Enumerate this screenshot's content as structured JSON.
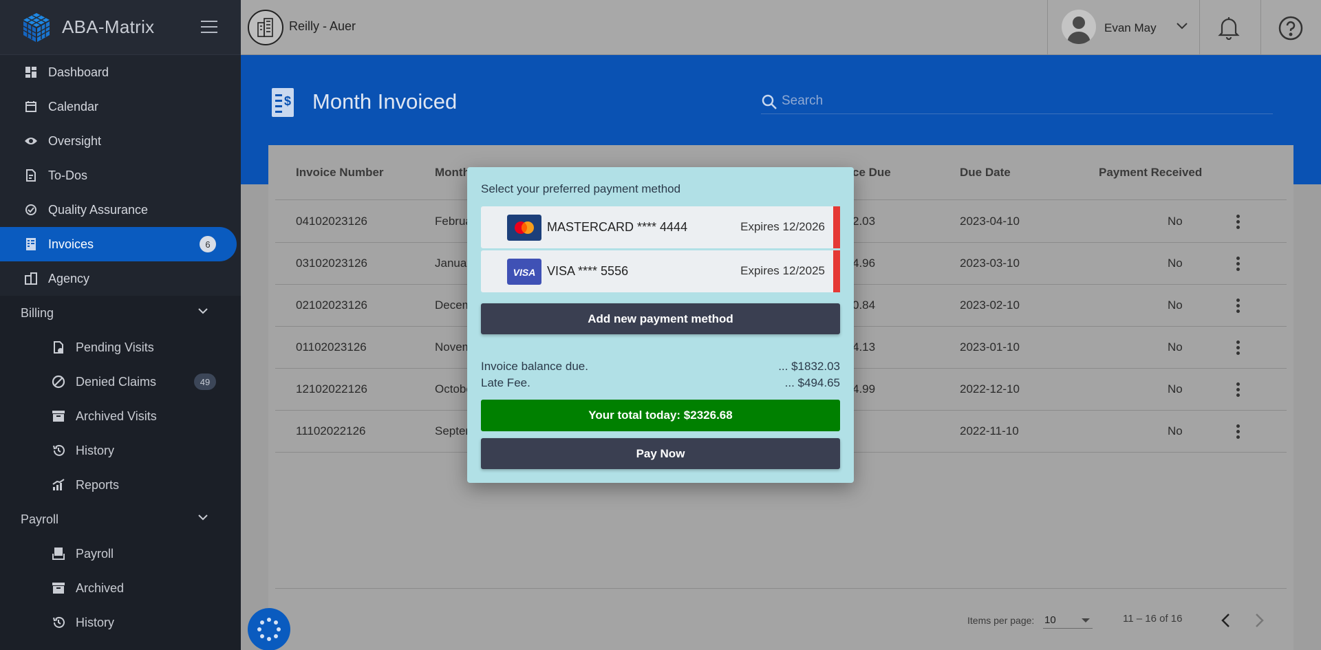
{
  "sidebar": {
    "brand": "ABA-Matrix",
    "items": [
      {
        "label": "Dashboard",
        "icon": "dashboard-icon"
      },
      {
        "label": "Calendar",
        "icon": "calendar-icon"
      },
      {
        "label": "Oversight",
        "icon": "eye-icon"
      },
      {
        "label": "To-Dos",
        "icon": "todo-icon"
      },
      {
        "label": "Quality Assurance",
        "icon": "quality-icon"
      },
      {
        "label": "Invoices",
        "icon": "invoice-icon",
        "badge": "6",
        "active": true
      },
      {
        "label": "Agency",
        "icon": "agency-icon"
      }
    ],
    "billing": {
      "label": "Billing",
      "items": [
        {
          "label": "Pending Visits",
          "icon": "pending-visits-icon"
        },
        {
          "label": "Denied Claims",
          "icon": "denied-icon",
          "badge": "49"
        },
        {
          "label": "Archived Visits",
          "icon": "archive-icon"
        },
        {
          "label": "History",
          "icon": "history-icon"
        },
        {
          "label": "Reports",
          "icon": "reports-icon"
        }
      ]
    },
    "payroll": {
      "label": "Payroll",
      "items": [
        {
          "label": "Payroll",
          "icon": "payroll-icon"
        },
        {
          "label": "Archived",
          "icon": "archive-icon"
        },
        {
          "label": "History",
          "icon": "history-icon"
        }
      ]
    }
  },
  "topbar": {
    "org_name": "Reilly - Auer",
    "user_name": "Evan May"
  },
  "header": {
    "title": "Month Invoiced",
    "search_placeholder": "Search"
  },
  "table": {
    "columns": [
      "Invoice Number",
      "Month I",
      "ce Due",
      "Due Date",
      "Payment Received"
    ],
    "rows": [
      {
        "invoice": "04102023126",
        "month": "Februar",
        "due": "2.03",
        "date": "2023-04-10",
        "received": "No"
      },
      {
        "invoice": "03102023126",
        "month": "January",
        "due": "4.96",
        "date": "2023-03-10",
        "received": "No"
      },
      {
        "invoice": "02102023126",
        "month": "Decemb",
        "due": "0.84",
        "date": "2023-02-10",
        "received": "No"
      },
      {
        "invoice": "01102023126",
        "month": "Novemb",
        "due": "4.13",
        "date": "2023-01-10",
        "received": "No"
      },
      {
        "invoice": "12102022126",
        "month": "October",
        "due": "4.99",
        "date": "2022-12-10",
        "received": "No"
      },
      {
        "invoice": "11102022126",
        "month": "Septem",
        "due": "",
        "date": "2022-11-10",
        "received": "No"
      }
    ]
  },
  "pagination": {
    "items_per_page_label": "Items per page:",
    "items_per_page": "10",
    "range": "11 – 16 of 16"
  },
  "modal": {
    "title": "Select your preferred payment method",
    "methods": [
      {
        "name": "MASTERCARD **** 4444",
        "expires": "Expires 12/2026",
        "brand": "mastercard"
      },
      {
        "name": "VISA **** 5556",
        "expires": "Expires 12/2025",
        "brand": "visa"
      }
    ],
    "add_label": "Add new payment method",
    "balance_label": "Invoice balance due.",
    "balance_value": "... $1832.03",
    "late_fee_label": "Late Fee.",
    "late_fee_value": "... $494.65",
    "total_label": "Your total today: $2326.68",
    "pay_label": "Pay Now",
    "accent_colors": {
      "total": "#008000",
      "stripe": "#e53935",
      "button": "#3a3f51"
    }
  }
}
